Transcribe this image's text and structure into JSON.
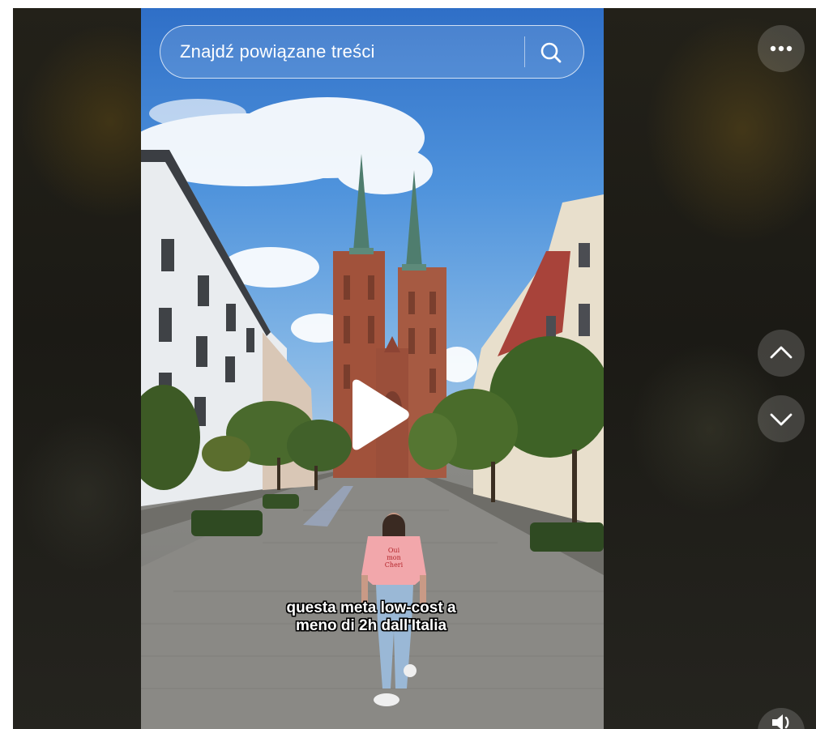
{
  "search": {
    "placeholder": "Znajdź powiązane treści"
  },
  "video": {
    "caption_line_1": "questa meta low-cost a",
    "caption_line_2": "meno di 2h dall'Italia",
    "shirt_text_line_1": "Oui",
    "shirt_text_line_2": "mon",
    "shirt_text_line_3": "Cheri"
  },
  "controls": {
    "more_icon": "more-horizontal-icon",
    "up_icon": "chevron-up-icon",
    "down_icon": "chevron-down-icon",
    "volume_icon": "volume-icon"
  },
  "colors": {
    "page_background": "#ffffff",
    "backdrop": "#1f1e19",
    "control_fill": "rgba(255,255,255,0.17)",
    "caption_text": "#ffffff",
    "caption_outline": "#000000"
  }
}
